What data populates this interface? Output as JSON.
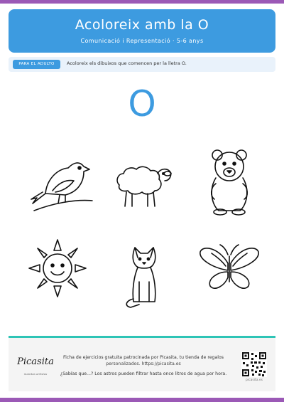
{
  "header": {
    "title": "Acoloreix amb la O",
    "subtitle": "Comunicació i Representació  ·  5-6 anys"
  },
  "instructions": {
    "badge": "PARA EL ADULTO",
    "text": "Acoloreix els dibuixos que comencen per la lletra O."
  },
  "big_letter": "O",
  "pictures": [
    {
      "icon": "bird-icon"
    },
    {
      "icon": "sheep-icon"
    },
    {
      "icon": "bear-icon"
    },
    {
      "icon": "sun-icon"
    },
    {
      "icon": "cat-icon"
    },
    {
      "icon": "butterfly-icon"
    }
  ],
  "footer": {
    "brand": "Picasita",
    "tagline": "manitas artistas",
    "line1": "Ficha de ejercicios gratuita patrocinada por Picasita, tu tienda de regalos",
    "line2": "personalizados. https://picasita.es",
    "fact": "¿Sabías que...? Los astros pueden filtrar hasta once litros de agua por hora.",
    "qr_caption": "picasita.es"
  },
  "colors": {
    "accent": "#3d9be0",
    "stripe": "#9b59b6",
    "footer_line": "#2ec4b6"
  }
}
